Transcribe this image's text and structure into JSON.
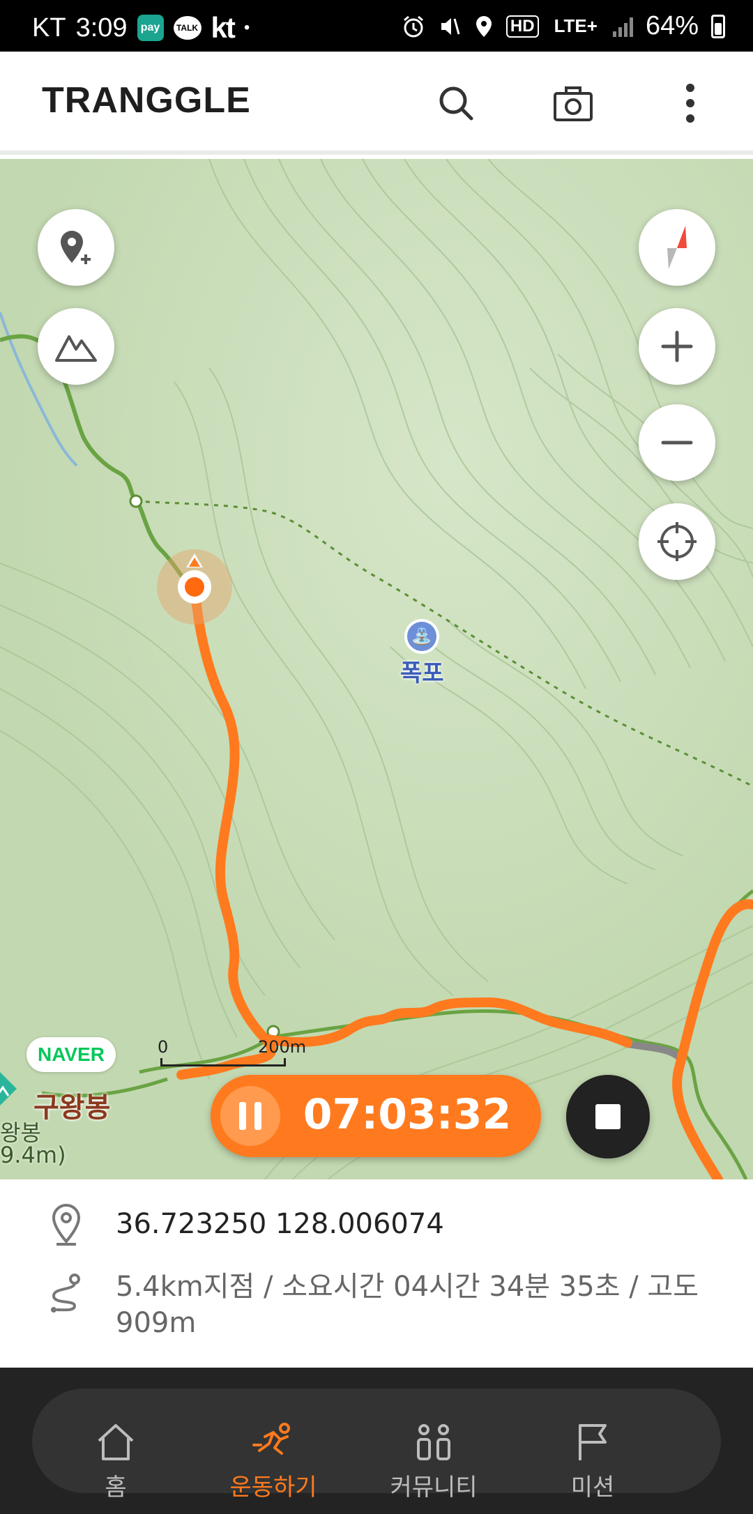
{
  "status_bar": {
    "carrier": "KT",
    "time": "3:09",
    "pay_icon_text": "pay",
    "talk_icon_text": "TALK",
    "kt_logo": "kt",
    "dot": "•",
    "hd_badge": "HD",
    "network": "LTE+",
    "battery": "64%"
  },
  "header": {
    "logo": "TRANGGLE",
    "icons": [
      "search-icon",
      "camera-icon",
      "more-vertical-icon"
    ]
  },
  "map": {
    "poi_label": "폭포",
    "peak_name": "구왕봉",
    "peak_sub1": "왕봉",
    "peak_sub2": "9.4m)",
    "naver_badge": "NAVER",
    "scale_start": "0",
    "scale_end": "200m",
    "controls": [
      "add-location-icon",
      "mountain-icon",
      "compass-icon",
      "zoom-in-icon",
      "zoom-out-icon",
      "locate-icon"
    ]
  },
  "recording": {
    "timer": "07:03:32",
    "pause_icon": "pause-icon",
    "stop_icon": "stop-icon"
  },
  "info": {
    "coordinates": "36.723250 128.006074",
    "progress": "5.4km지점 / 소요시간 04시간 34분 35초 / 고도 909m"
  },
  "nav": {
    "items": [
      {
        "label": "홈",
        "icon": "home-icon",
        "active": false
      },
      {
        "label": "운동하기",
        "icon": "running-icon",
        "active": true
      },
      {
        "label": "커뮤니티",
        "icon": "community-icon",
        "active": false
      },
      {
        "label": "미션",
        "icon": "flag-icon",
        "active": false
      }
    ]
  },
  "colors": {
    "accent": "#ff7a1e",
    "map_green": "#c6dcb5",
    "trail_green": "#6aa343",
    "nav_bg": "#232323"
  }
}
